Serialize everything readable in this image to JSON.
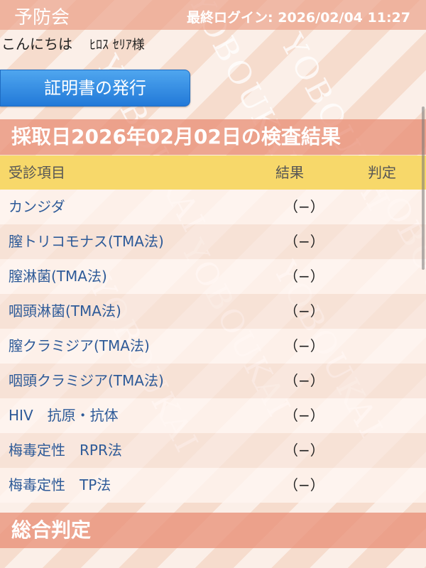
{
  "watermark": "YOBOUKAI",
  "header": {
    "app_title": "予防会",
    "last_login": "最終ログイン: 2026/02/04 11:27"
  },
  "greeting": {
    "text": "こんにちは",
    "name": "ﾋﾛｽ ｾﾘｱ様"
  },
  "certificate_button": "証明書の発行",
  "results_section_title": "採取日2026年02月02日の検査結果",
  "table": {
    "columns": [
      "受診項目",
      "結果",
      "判定"
    ],
    "rows": [
      {
        "item": "カンジダ",
        "result": "（−）",
        "judge": ""
      },
      {
        "item": "膣トリコモナス(TMA法)",
        "result": "（−）",
        "judge": ""
      },
      {
        "item": "膣淋菌(TMA法)",
        "result": "（−）",
        "judge": ""
      },
      {
        "item": "咽頭淋菌(TMA法)",
        "result": "（−）",
        "judge": ""
      },
      {
        "item": "膣クラミジア(TMA法)",
        "result": "（−）",
        "judge": ""
      },
      {
        "item": "咽頭クラミジア(TMA法)",
        "result": "（−）",
        "judge": ""
      },
      {
        "item": "HIV　抗原・抗体",
        "result": "（−）",
        "judge": ""
      },
      {
        "item": "梅毒定性　RPR法",
        "result": "（−）",
        "judge": ""
      },
      {
        "item": "梅毒定性　TP法",
        "result": "（−）",
        "judge": ""
      }
    ]
  },
  "overall_section_title": "総合判定",
  "colors": {
    "header_bg": "#eca38c",
    "section_bg": "#e99178",
    "table_head_bg": "#f7d86a",
    "button_bg": "#3a8fe4",
    "item_text": "#2d5a98"
  }
}
